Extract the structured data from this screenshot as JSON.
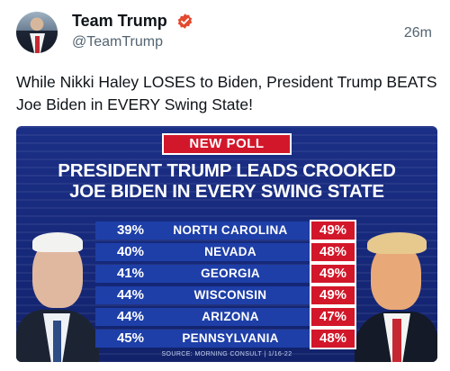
{
  "tweet": {
    "display_name": "Team Trump",
    "handle": "@TeamTrump",
    "time": "26m",
    "verified_icon": "verified-badge-icon",
    "text": "While Nikki Haley LOSES to Biden, President Trump BEATS Joe Biden in EVERY Swing State!"
  },
  "card": {
    "badge": "NEW POLL",
    "headline_line1": "PRESIDENT TRUMP LEADS CROOKED",
    "headline_line2": "JOE BIDEN IN EVERY SWING STATE",
    "source": "SOURCE: MORNING CONSULT | 1/16-22",
    "rows": [
      {
        "state": "NORTH CAROLINA",
        "biden": "39%",
        "trump": "49%"
      },
      {
        "state": "NEVADA",
        "biden": "40%",
        "trump": "48%"
      },
      {
        "state": "GEORGIA",
        "biden": "41%",
        "trump": "49%"
      },
      {
        "state": "WISCONSIN",
        "biden": "44%",
        "trump": "49%"
      },
      {
        "state": "ARIZONA",
        "biden": "44%",
        "trump": "47%"
      },
      {
        "state": "PENNSYLVANIA",
        "biden": "45%",
        "trump": "48%"
      }
    ],
    "colors": {
      "accent_red": "#d3172a",
      "navy": "#16287a",
      "row_blue": "#1e3fa8"
    }
  }
}
